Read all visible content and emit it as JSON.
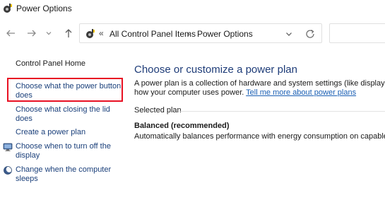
{
  "window": {
    "title": "Power Options"
  },
  "toolbar": {
    "back_icon": "arrow-left-icon",
    "forward_icon": "arrow-right-icon",
    "recent_icon": "chevron-down-icon",
    "up_icon": "arrow-up-icon",
    "address": {
      "separator": "«",
      "crumbs": [
        "All Control Panel Items",
        "Power Options"
      ],
      "crumb_separator": "›"
    },
    "refresh_icon": "refresh-icon"
  },
  "sidebar": {
    "home_label": "Control Panel Home",
    "links": [
      {
        "lines": [
          "Choose what the power button",
          "does"
        ],
        "highlighted": true
      },
      {
        "lines": [
          "Choose what closing the lid",
          "does"
        ]
      },
      {
        "lines": [
          "Create a power plan"
        ]
      },
      {
        "lines": [
          "Choose when to turn off the",
          "display"
        ],
        "icon": "monitor-icon"
      },
      {
        "lines": [
          "Change when the computer",
          "sleeps"
        ],
        "icon": "moon-icon"
      }
    ]
  },
  "main": {
    "heading": "Choose or customize a power plan",
    "desc_line1": "A power plan is a collection of hardware and system settings (like display brigh",
    "desc_line2_prefix": "how your computer uses power. ",
    "desc_link": "Tell me more about power plans",
    "selected_plan_label": "Selected plan",
    "plan_name": "Balanced (recommended)",
    "plan_desc": "Automatically balances performance with energy consumption on capable ha"
  },
  "colors": {
    "heading": "#1e3c78",
    "link": "#1a3f7a",
    "highlight_border": "#e81123"
  }
}
